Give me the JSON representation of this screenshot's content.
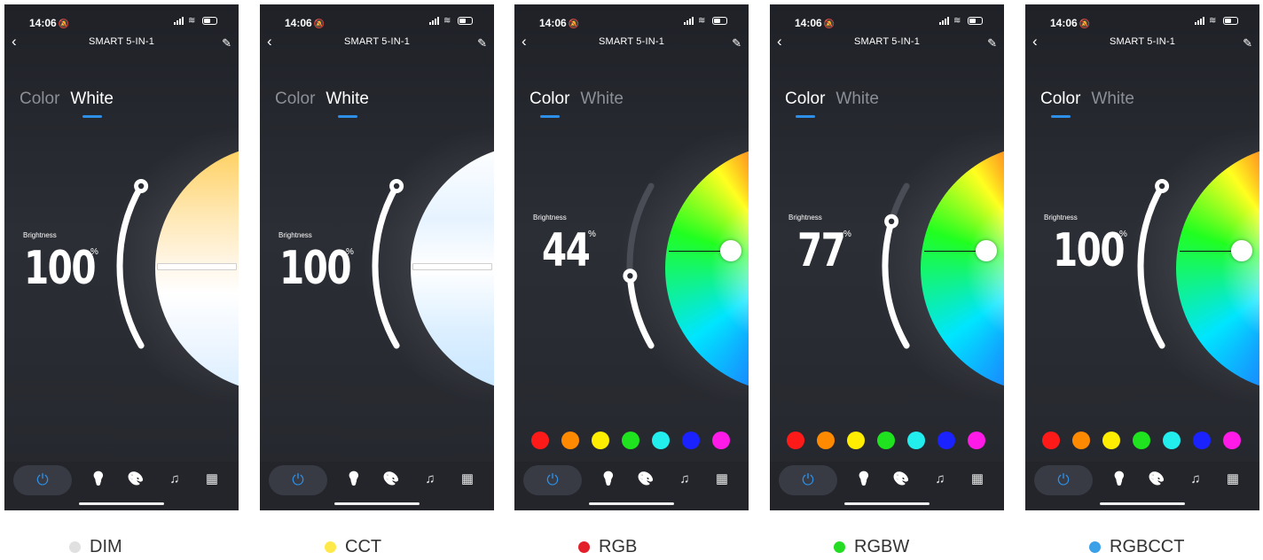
{
  "status_time": "14:06",
  "app_title": "SMART 5-IN-1",
  "tabs": [
    "Color",
    "White"
  ],
  "brightness_label": "Brightness",
  "percent": "%",
  "phones": [
    {
      "active_tab": "White",
      "brightness": "100",
      "brightness_fraction": 1.0,
      "mode": "white-warm",
      "caption": "DIM",
      "caption_dot": "#e0e0e0"
    },
    {
      "active_tab": "White",
      "brightness": "100",
      "brightness_fraction": 1.0,
      "mode": "white-cool",
      "caption": "CCT",
      "caption_dot": "#ffe94a"
    },
    {
      "active_tab": "Color",
      "brightness": "44",
      "brightness_fraction": 0.44,
      "mode": "color",
      "caption": "RGB",
      "caption_dot": "#e3202a"
    },
    {
      "active_tab": "Color",
      "brightness": "77",
      "brightness_fraction": 0.77,
      "mode": "color",
      "caption": "RGBW",
      "caption_dot": "#22dd22"
    },
    {
      "active_tab": "Color",
      "brightness": "100",
      "brightness_fraction": 1.0,
      "mode": "color",
      "caption": "RGBCCT",
      "caption_dot": "#3aa0e8"
    }
  ],
  "swatch_colors": [
    "#ff1a1a",
    "#ff8a00",
    "#ffee00",
    "#1ee31e",
    "#22eeee",
    "#1a22ff",
    "#ff1ae8"
  ],
  "nav_icons": [
    "power-icon",
    "bulb-icon",
    "palette-icon",
    "music-icon",
    "scenes-icon"
  ],
  "accent": "#2e8fe6"
}
